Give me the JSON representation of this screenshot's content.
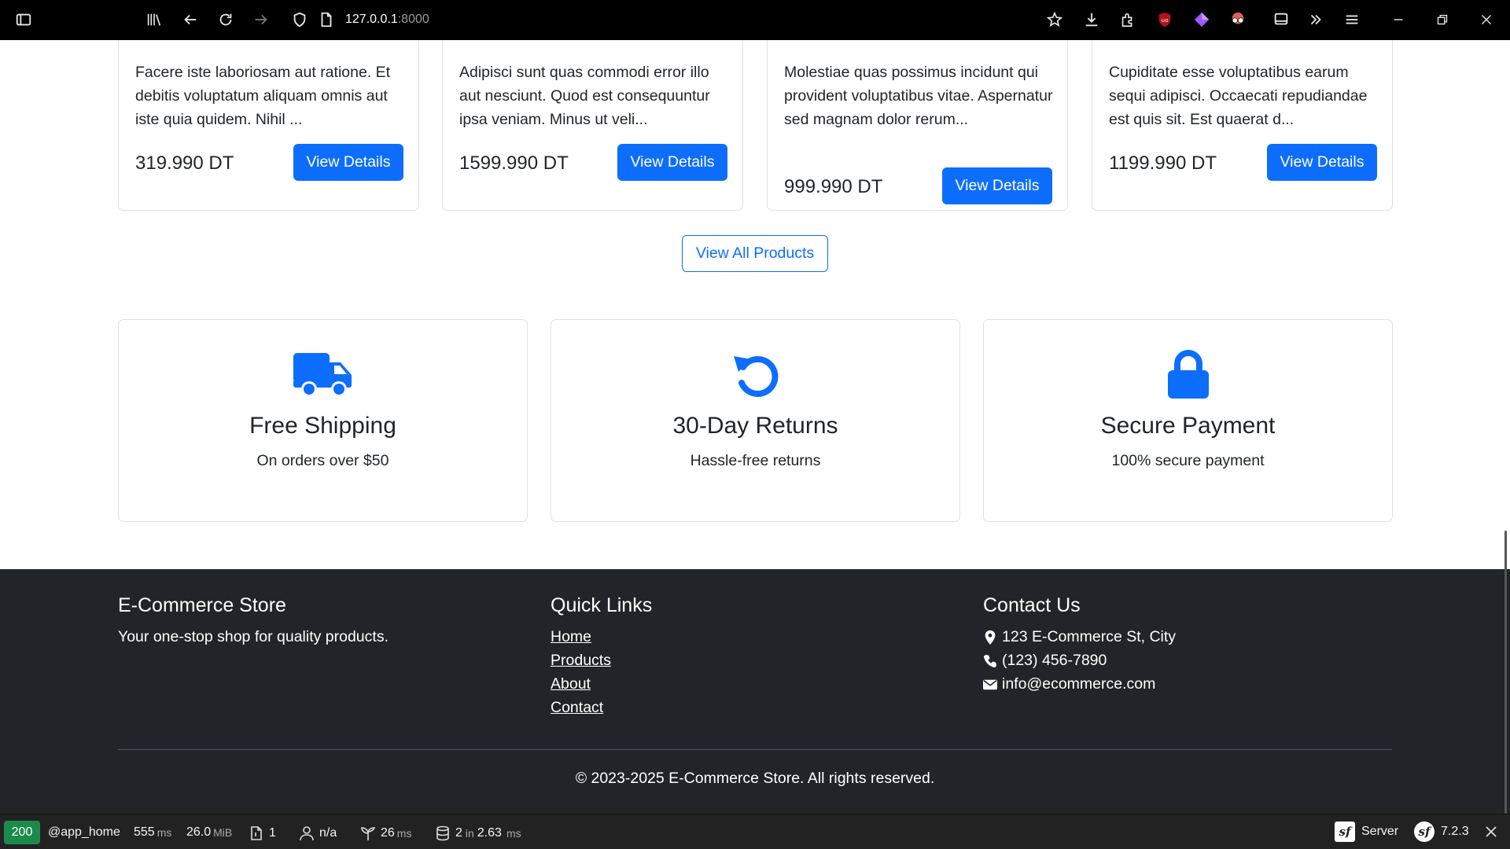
{
  "browser": {
    "url_host": "127.0.0.1",
    "url_port": ":8000"
  },
  "products": [
    {
      "description": "Facere iste laboriosam aut ratione. Et debitis voluptatum aliquam omnis aut iste quia quidem. Nihil ...",
      "price": "319.990 DT",
      "button": "View Details"
    },
    {
      "description": "Adipisci sunt quas commodi error illo aut nesciunt. Quod est consequuntur ipsa veniam. Minus ut veli...",
      "price": "1599.990 DT",
      "button": "View Details"
    },
    {
      "description": "Molestiae quas possimus incidunt qui provident voluptatibus vitae. Aspernatur sed magnam dolor rerum...",
      "price": "999.990 DT",
      "button": "View Details"
    },
    {
      "description": "Cupiditate esse voluptatibus earum sequi adipisci. Occaecati repudiandae est quis sit. Est quaerat d...",
      "price": "1199.990 DT",
      "button": "View Details"
    }
  ],
  "view_all_label": "View All Products",
  "features": [
    {
      "icon": "truck-icon",
      "title": "Free Shipping",
      "subtitle": "On orders over $50"
    },
    {
      "icon": "undo-icon",
      "title": "30-Day Returns",
      "subtitle": "Hassle-free returns"
    },
    {
      "icon": "lock-icon",
      "title": "Secure Payment",
      "subtitle": "100% secure payment"
    }
  ],
  "footer": {
    "store_title": "E-Commerce Store",
    "store_tagline": "Your one-stop shop for quality products.",
    "quick_links_title": "Quick Links",
    "links": [
      "Home",
      "Products",
      "About",
      "Contact"
    ],
    "contact_title": "Contact Us",
    "address": "123 E-Commerce St, City",
    "phone": "(123) 456-7890",
    "email": "info@ecommerce.com",
    "copyright": "© 2023-2025 E-Commerce Store. All rights reserved."
  },
  "debug": {
    "status": "200",
    "route": "@app_home",
    "time_value": "555",
    "time_unit": "ms",
    "memory_value": "26.0",
    "memory_unit": "MiB",
    "forms": "1",
    "user": "n/a",
    "twig_value": "26",
    "twig_unit": "ms",
    "db_queries": "2",
    "db_in": "in",
    "db_time": "2.63",
    "db_unit": "ms",
    "server_label": "Server",
    "version": "7.2.3"
  },
  "colors": {
    "primary": "#0d6efd",
    "footer_bg": "#212529",
    "status_ok": "#1c8a4a"
  }
}
